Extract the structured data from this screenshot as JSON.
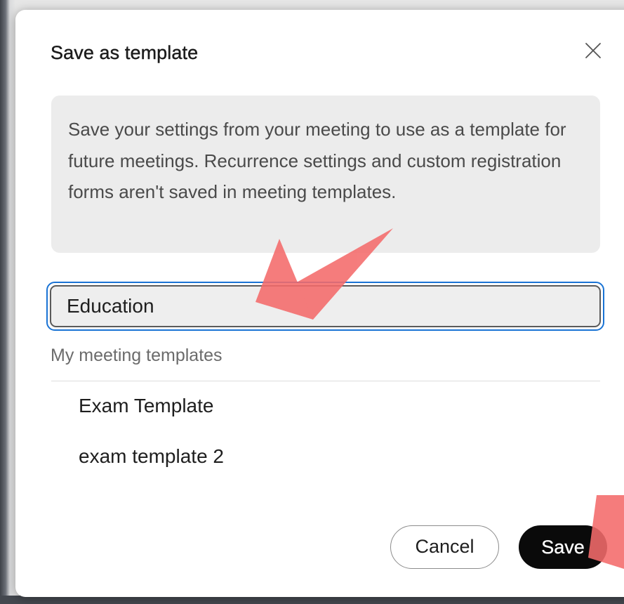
{
  "dialog": {
    "title": "Save as template",
    "close_icon": "close-icon",
    "info_text": "Save your settings from your meeting to use as a template for future meetings. Recurrence settings and custom registration forms aren't saved in meeting templates.",
    "template_name_value": "Education",
    "templates_label": "My meeting templates",
    "templates": [
      {
        "label": "Exam Template"
      },
      {
        "label": "exam template 2"
      }
    ],
    "cancel_label": "Cancel",
    "save_label": "Save"
  },
  "colors": {
    "focus_ring": "#1a73d4",
    "primary_button": "#0a0a0a",
    "annotation_arrow": "#f46b6b",
    "info_background": "#ececec"
  }
}
